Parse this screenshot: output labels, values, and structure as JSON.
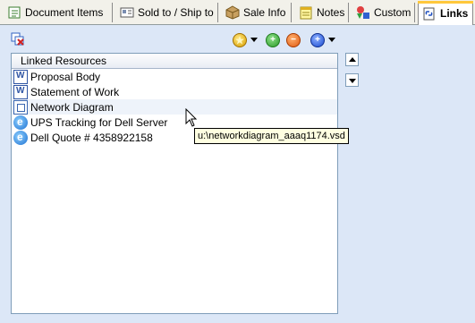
{
  "tabs": [
    {
      "label": "Document Items",
      "icon": "document-items-icon",
      "active": false
    },
    {
      "label": "Sold to / Ship to",
      "icon": "address-card-icon",
      "active": false
    },
    {
      "label": "Sale Info",
      "icon": "package-icon",
      "active": false
    },
    {
      "label": "Notes",
      "icon": "notepad-icon",
      "active": false
    },
    {
      "label": "Custom",
      "icon": "shapes-icon",
      "active": false
    },
    {
      "label": "Links",
      "icon": "links-icon",
      "active": true
    }
  ],
  "toolbar": {
    "icons": [
      "remove-link-icon",
      "star-icon",
      "add-icon",
      "remove-icon",
      "new-icon"
    ]
  },
  "list": {
    "header": "Linked Resources",
    "items": [
      {
        "label": "Proposal Body",
        "icon": "word-document-icon"
      },
      {
        "label": "Statement of Work",
        "icon": "word-document-icon"
      },
      {
        "label": "Network Diagram",
        "icon": "visio-document-icon"
      },
      {
        "label": "UPS Tracking for Dell Server",
        "icon": "web-link-icon"
      },
      {
        "label": "Dell Quote # 4358922158",
        "icon": "web-link-icon"
      }
    ]
  },
  "tooltip": "u:\\networkdiagram_aaaq1174.vsd",
  "colors": {
    "accent": "#ffc83c",
    "background": "#dce7f7",
    "border": "#7f9db9"
  }
}
